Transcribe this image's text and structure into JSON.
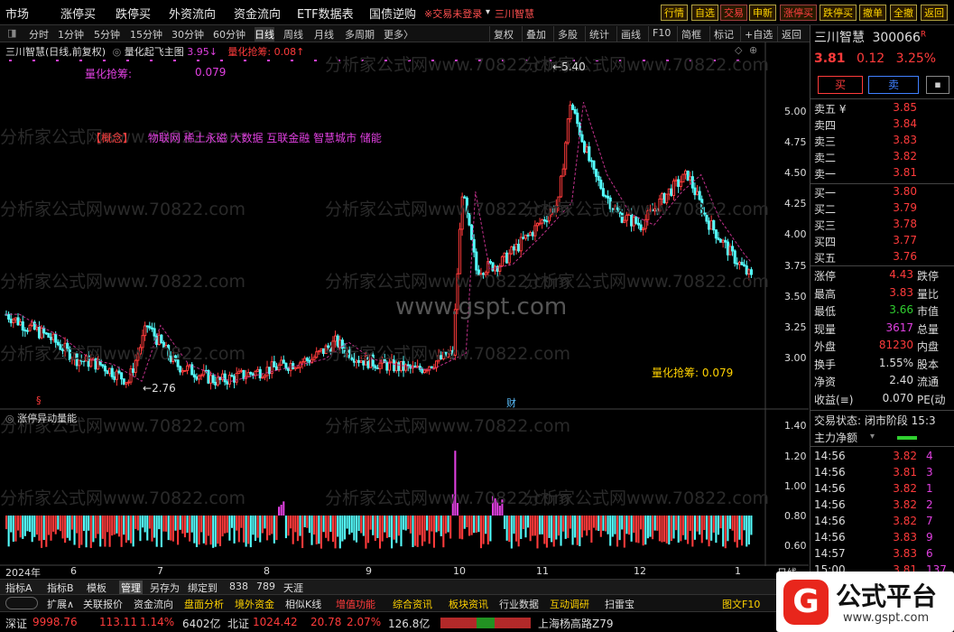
{
  "menu": {
    "items": [
      "市场",
      "涨停买",
      "跌停买",
      "外资流向",
      "资金流向",
      "ETF数据表",
      "国债逆购"
    ],
    "login_notice": "※交易未登录",
    "stock_tag": "三川智慧",
    "toolbar": [
      "行情",
      "自选",
      "交易",
      "申新",
      "涨停买",
      "跌停买",
      "撤单",
      "全撤",
      "返回"
    ]
  },
  "period": {
    "tabs": [
      "分时",
      "1分钟",
      "5分钟",
      "15分钟",
      "30分钟",
      "60分钟",
      "日线",
      "周线",
      "月线",
      "多周期",
      "更多〉"
    ],
    "active": "日线",
    "right": [
      "复权",
      "叠加",
      "多股",
      "统计",
      "画线",
      "F10",
      "简框",
      "标记",
      "+自选",
      "返回"
    ]
  },
  "chart": {
    "header_name": "三川智慧(日线,前复权)",
    "indicator_name": "量化起飞主图",
    "ind_value_label": "3.95↓",
    "ind_value2_label": "量化抢筹: 0.08↑",
    "line1_label": "量化抢筹:",
    "line1_value": "0.079",
    "concept_label": "【概念】",
    "concepts": "物联网  稀土永磁  大数据  互联金融  智慧城市  储能",
    "high_label": "5.40",
    "low_label": "2.76",
    "bottom_label": "量化抢筹:",
    "bottom_value": "0.079",
    "watermark_site": "www.gspt.com",
    "watermark_text": "分析家公式网www.70822.com",
    "price_ticks": [
      "5.00",
      "4.75",
      "4.50",
      "4.25",
      "4.00",
      "3.75",
      "3.50",
      "3.25",
      "3.00"
    ],
    "marker_s": "§",
    "marker_cai": "财",
    "sub_title": "涨停异动量能",
    "vol_ticks": [
      "1.40",
      "1.20",
      "1.00",
      "0.80",
      "0.60"
    ],
    "date_labels": [
      "2024年",
      "6",
      "7",
      "8",
      "9",
      "10",
      "11",
      "12",
      "1"
    ],
    "period_label": "日线"
  },
  "chart_data": {
    "type": "candlestick",
    "title": "三川智慧(日线,前复权)",
    "y_range": [
      2.7,
      5.45
    ],
    "high": 5.4,
    "low": 2.76,
    "last": 3.81,
    "months": [
      "2024年",
      "6",
      "7",
      "8",
      "9",
      "10",
      "11",
      "12",
      "1"
    ],
    "sub_indicator": "涨停异动量能",
    "sub_range": [
      0.5,
      1.45
    ]
  },
  "quote": {
    "name": "三川智慧",
    "code": "300066",
    "flag": "R",
    "price": "3.81",
    "change": "0.12",
    "pct": "3.25%",
    "buy": "买",
    "sell": "卖",
    "asks": [
      {
        "l": "卖五 ¥",
        "p": "3.85"
      },
      {
        "l": "卖四",
        "p": "3.84"
      },
      {
        "l": "卖三",
        "p": "3.83"
      },
      {
        "l": "卖二",
        "p": "3.82"
      },
      {
        "l": "卖一",
        "p": "3.81"
      }
    ],
    "bids": [
      {
        "l": "买一",
        "p": "3.80"
      },
      {
        "l": "买二",
        "p": "3.79"
      },
      {
        "l": "买三",
        "p": "3.78"
      },
      {
        "l": "买四",
        "p": "3.77"
      },
      {
        "l": "买五",
        "p": "3.76"
      }
    ],
    "info": [
      {
        "l": "涨停",
        "v": "4.43",
        "c": "#ff3b3b",
        "r": "跌停"
      },
      {
        "l": "最高",
        "v": "3.83",
        "c": "#ff3b3b",
        "r": "量比"
      },
      {
        "l": "最低",
        "v": "3.66",
        "c": "#30d030",
        "r": "市值"
      },
      {
        "l": "现量",
        "v": "3617",
        "c": "#e040e0",
        "r": "总量"
      },
      {
        "l": "外盘",
        "v": "81230",
        "c": "#ff3b3b",
        "r": "内盘"
      },
      {
        "l": "换手",
        "v": "1.55%",
        "c": "#ddd",
        "r": "股本"
      },
      {
        "l": "净资",
        "v": "2.40",
        "c": "#ddd",
        "r": "流通"
      },
      {
        "l": "收益(≡)",
        "v": "0.070",
        "c": "#ddd",
        "r": "PE(动"
      }
    ],
    "trade_status": "交易状态: 闭市阶段 15:3",
    "main_flow": "主力净额",
    "ticks": [
      {
        "t": "14:56",
        "p": "3.82",
        "v": "4"
      },
      {
        "t": "14:56",
        "p": "3.81",
        "v": "3"
      },
      {
        "t": "14:56",
        "p": "3.82",
        "v": "1"
      },
      {
        "t": "14:56",
        "p": "3.82",
        "v": "2"
      },
      {
        "t": "14:56",
        "p": "3.82",
        "v": "7"
      },
      {
        "t": "14:56",
        "p": "3.83",
        "v": "9"
      },
      {
        "t": "14:57",
        "p": "3.83",
        "v": "6"
      },
      {
        "t": "15:00",
        "p": "3.81",
        "v": "137"
      }
    ]
  },
  "tabs1": [
    "指标A",
    "指标B",
    "模板",
    "管理",
    "另存为",
    "绑定到",
    "838",
    "789",
    "天涯"
  ],
  "tabs2": [
    "扩展∧",
    "关联报价",
    "资金流向",
    "盘面分析",
    "境外资金",
    "相似K线",
    "增值功能",
    "综合资讯",
    "板块资讯",
    "行业数据",
    "互动调研",
    "扫雷宝"
  ],
  "tabs2_right": "图文F10",
  "status": {
    "sh_label": "深证",
    "sh_val": "9998.76",
    "sh_chg": "113.11",
    "sh_pct": "1.14%",
    "sh_amt": "6402亿",
    "bz_label": "北证",
    "bz_val": "1024.42",
    "bz_chg": "20.78",
    "bz_pct": "2.07%",
    "bz_amt": "126.8亿",
    "news": "上海杨高路Z79"
  },
  "brand": {
    "name": "公式平台",
    "url": "www.gspt.com",
    "logo": "G"
  }
}
